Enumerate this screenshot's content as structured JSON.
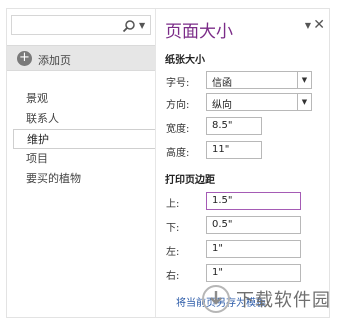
{
  "search": {
    "icon": "search-icon",
    "dropdown": "chevron-down-icon"
  },
  "left_panel": {
    "add_page_label": "添加页",
    "pages": [
      {
        "label": "景观",
        "active": false
      },
      {
        "label": "联系人",
        "active": false
      },
      {
        "label": "维护",
        "active": true
      },
      {
        "label": "项目",
        "active": false
      },
      {
        "label": "要买的植物",
        "active": false
      }
    ]
  },
  "pane": {
    "title": "页面大小",
    "close_glyph": "✕",
    "dropdown_glyph": "▼",
    "paper_size": {
      "heading": "纸张大小",
      "size_label": "字号:",
      "size_value": "信函",
      "orientation_label": "方向:",
      "orientation_value": "纵向",
      "width_label": "宽度:",
      "width_value": "8.5\"",
      "height_label": "高度:",
      "height_value": "11\""
    },
    "margins": {
      "heading": "打印页边距",
      "top_label": "上:",
      "top_value": "1.5\"",
      "bottom_label": "下:",
      "bottom_value": "0.5\"",
      "left_label": "左:",
      "left_value": "1\"",
      "right_label": "右:",
      "right_value": "1\""
    },
    "save_template_link": "将当前页另存为模板"
  },
  "watermark": {
    "text": "下载软件园"
  },
  "colors": {
    "accent": "#7b2c88",
    "link": "#2a5aa8",
    "focus": "#a55bb5"
  }
}
